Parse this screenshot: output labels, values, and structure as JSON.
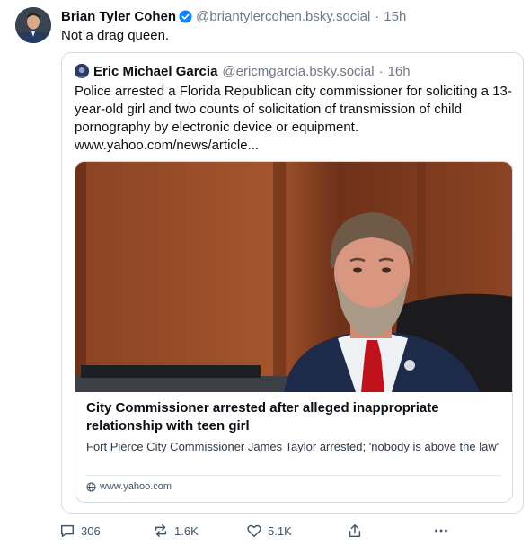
{
  "post": {
    "author_name": "Brian Tyler Cohen",
    "author_handle": "@briantylercohen.bsky.social",
    "separator": "·",
    "timestamp": "15h",
    "text": "Not a drag queen."
  },
  "quote": {
    "author_name": "Eric Michael Garcia",
    "author_handle": "@ericmgarcia.bsky.social",
    "separator": "·",
    "timestamp": "16h",
    "text": "Police arrested a Florida Republican city commissioner for soliciting a 13-year-old girl and two counts of solicitation of transmission of child pornography by electronic device or equipment. www.yahoo.com/news/article..."
  },
  "link_card": {
    "title": "City Commissioner arrested after alleged inappropriate relationship with teen girl",
    "description": "Fort Pierce City Commissioner James Taylor arrested; 'nobody is above the law'",
    "domain": "www.yahoo.com"
  },
  "actions": {
    "replies": "306",
    "reposts": "1.6K",
    "likes": "5.1K"
  },
  "colors": {
    "accent": "#1083fe",
    "muted_text": "#6f7a86",
    "border": "#d4dbe2"
  },
  "icons": {
    "verified": "verified-badge-icon",
    "reply": "reply-icon",
    "repost": "repost-icon",
    "like": "heart-icon",
    "share": "share-icon",
    "more": "more-icon",
    "globe": "globe-icon"
  }
}
